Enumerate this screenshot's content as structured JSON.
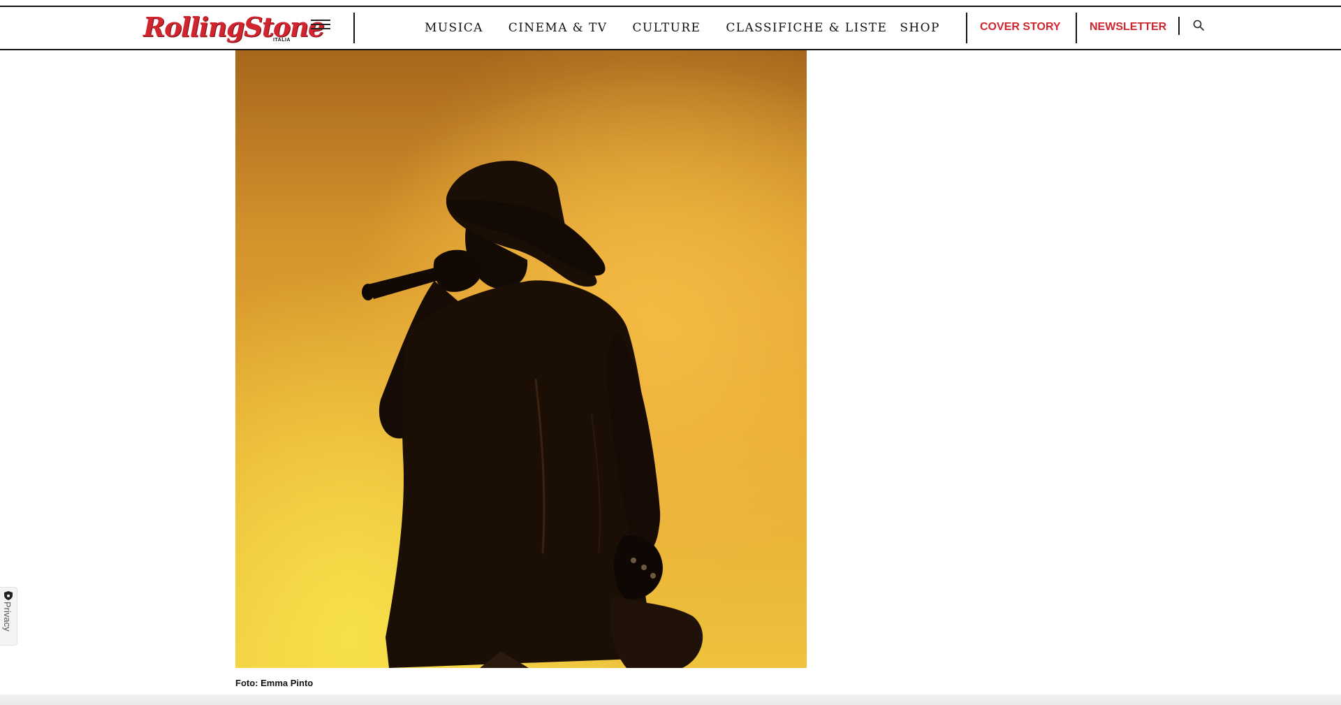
{
  "header": {
    "logo_text": "RollingStone",
    "logo_sub": "ITALIA",
    "nav": [
      {
        "label": "MUSICA"
      },
      {
        "label": "CINEMA & TV"
      },
      {
        "label": "CULTURE"
      },
      {
        "label": "CLASSIFICHE & LISTE"
      },
      {
        "label": "SHOP"
      }
    ],
    "cover_story": "COVER STORY",
    "newsletter": "NEWSLETTER",
    "accent_color": "#d0252f"
  },
  "main": {
    "caption": "Foto: Emma Pinto"
  },
  "privacy": {
    "label": "Privacy"
  }
}
